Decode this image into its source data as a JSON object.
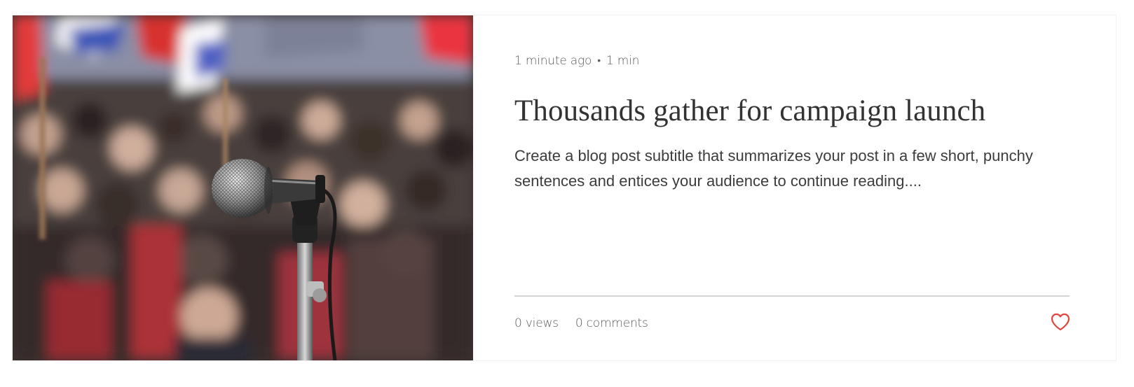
{
  "post": {
    "time_ago": "1 minute ago",
    "separator": "•",
    "read_time": "1 min",
    "title": "Thousands gather for campaign launch",
    "subtitle": "Create a blog post subtitle that summarizes your post in a few short, punchy sentences and entices your audience to continue reading....",
    "image_alt": "Microphone on a stand in front of a blurred crowd with red and white flags"
  },
  "stats": {
    "views": "0 views",
    "comments": "0 comments"
  },
  "icons": {
    "like": "heart-icon"
  },
  "colors": {
    "like_accent": "#e0443a",
    "meta_text": "#5c5c5c",
    "title_text": "#333333"
  }
}
